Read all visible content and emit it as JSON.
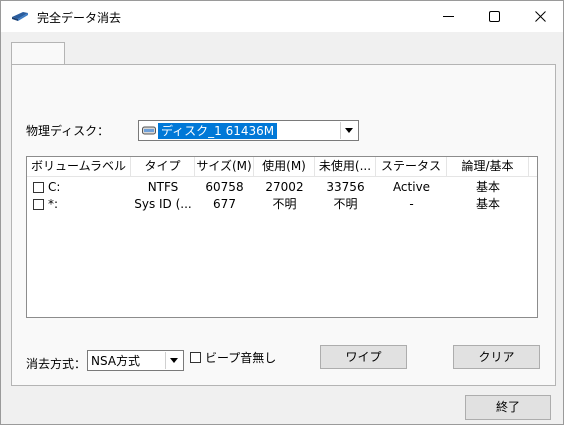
{
  "window": {
    "title": "完全データ消去",
    "icon": "eraser-app-icon"
  },
  "disk": {
    "label": "物理ディスク：",
    "selected": "ディスク_1  61436M",
    "icon": "hard-disk-icon"
  },
  "table": {
    "columns": [
      "ボリュームラベル",
      "タイプ",
      "サイズ(M)",
      "使用(M)",
      "未使用(...",
      "ステータス",
      "論理/基本"
    ],
    "rows": [
      {
        "label": "C:",
        "type": "NTFS",
        "size": "60758",
        "used": "27002",
        "unused": "33756",
        "status": "Active",
        "kind": "基本",
        "checked": false
      },
      {
        "label": "*:",
        "type": "Sys ID (...",
        "size": "677",
        "used": "不明",
        "unused": "不明",
        "status": "-",
        "kind": "基本",
        "checked": false
      }
    ]
  },
  "method": {
    "label": "消去方式：",
    "value": "NSA方式"
  },
  "beep": {
    "label": "ビープ音無し",
    "checked": false
  },
  "buttons": {
    "wipe": "ワイプ",
    "clear": "クリア",
    "exit": "終了"
  }
}
